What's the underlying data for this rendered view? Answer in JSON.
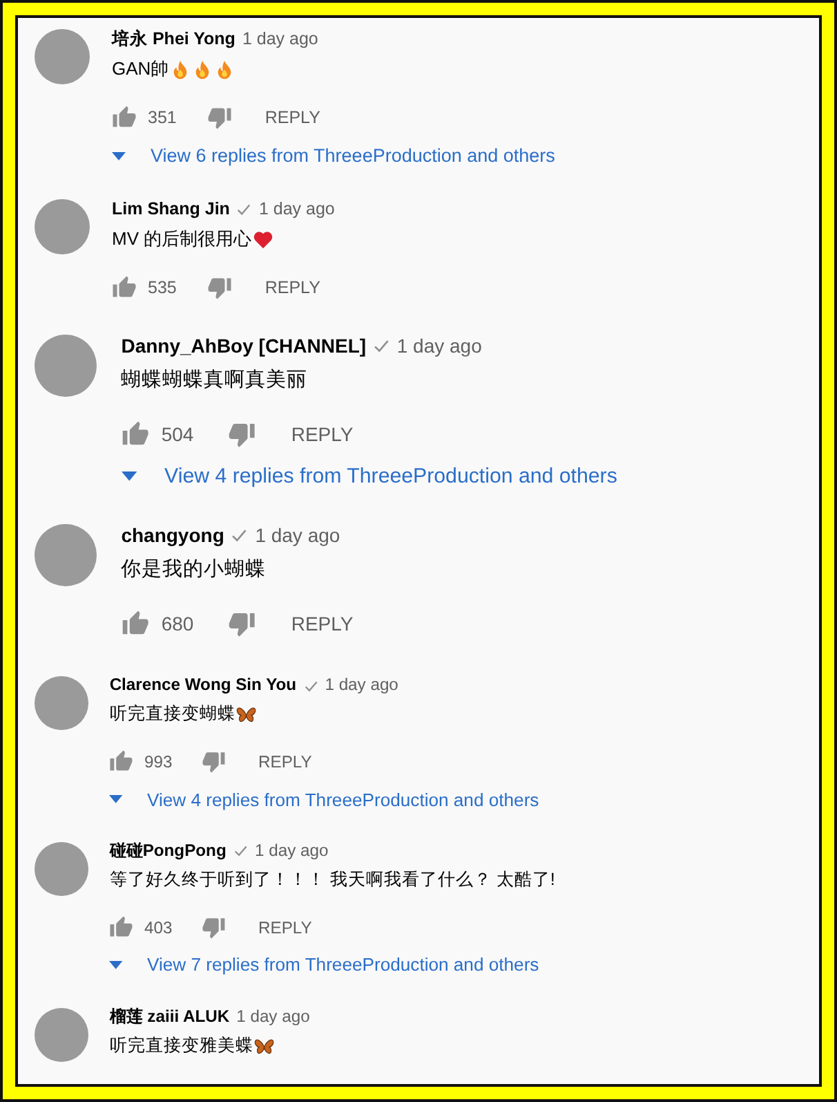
{
  "comments": [
    {
      "author": "培永 Phei Yong",
      "verified": false,
      "time": "1 day ago",
      "text": "GAN帥",
      "emoji": [
        {
          "kind": "fire"
        },
        {
          "kind": "fire"
        },
        {
          "kind": "fire"
        }
      ],
      "likes": "351",
      "reply": "REPLY",
      "replies": "View 6 replies from ThreeeProduction and others"
    },
    {
      "author": "Lim Shang Jin",
      "verified": true,
      "time": "1 day ago",
      "text": "MV 的后制很用心",
      "emoji": [
        {
          "kind": "heart"
        }
      ],
      "likes": "535",
      "reply": "REPLY"
    },
    {
      "author": "Danny_AhBoy [CHANNEL]",
      "verified": true,
      "time": "1 day ago",
      "text": "蝴蝶蝴蝶真啊真美丽",
      "likes": "504",
      "reply": "REPLY",
      "replies": "View 4 replies from ThreeeProduction and others"
    },
    {
      "author": "changyong",
      "verified": true,
      "time": "1 day ago",
      "text": "你是我的小蝴蝶",
      "likes": "680",
      "reply": "REPLY"
    },
    {
      "author": "Clarence Wong Sin You",
      "verified": true,
      "time": "1 day ago",
      "text": "听完直接变蝴蝶",
      "emoji": [
        {
          "kind": "butterfly"
        }
      ],
      "likes": "993",
      "reply": "REPLY",
      "replies": "View 4 replies from ThreeeProduction and others"
    },
    {
      "author": "碰碰PongPong",
      "verified": true,
      "time": "1 day ago",
      "text": "等了好久终于听到了！！！ 我天啊我看了什么？ 太酷了!",
      "likes": "403",
      "reply": "REPLY",
      "replies": "View 7 replies from ThreeeProduction and others"
    },
    {
      "author": "榴莲 zaiii ALUK",
      "verified": false,
      "time": "1 day ago",
      "text": "听完直接变雅美蝶",
      "emoji": [
        {
          "kind": "butterfly"
        }
      ]
    }
  ]
}
